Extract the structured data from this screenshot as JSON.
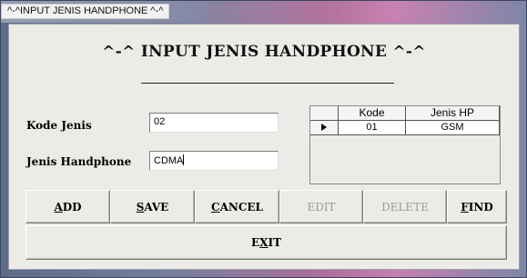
{
  "window": {
    "title": "^-^INPUT JENIS HANDPHONE ^-^"
  },
  "form": {
    "heading": "^-^ INPUT JENIS HANDPHONE ^-^",
    "kode_label": "Kode Jenis",
    "kode_value": "02",
    "jenis_label": "Jenis Handphone",
    "jenis_value": "CDMA"
  },
  "grid": {
    "columns": [
      "Kode",
      "Jenis HP"
    ],
    "rows": [
      {
        "kode": "01",
        "jenis": "GSM",
        "selected": true
      }
    ]
  },
  "buttons": {
    "add": {
      "mnemonic": "A",
      "rest": "DD",
      "enabled": true
    },
    "save": {
      "mnemonic": "S",
      "rest": "AVE",
      "enabled": true
    },
    "cancel": {
      "mnemonic": "C",
      "rest": "ANCEL",
      "enabled": true
    },
    "edit": {
      "label": "EDIT",
      "enabled": false
    },
    "delete": {
      "label": "DELETE",
      "enabled": false
    },
    "find": {
      "mnemonic": "F",
      "rest": "IND",
      "enabled": true
    },
    "exit": {
      "prefix": "E",
      "mnemonic": "X",
      "rest": "IT",
      "enabled": true
    }
  },
  "icons": {
    "row_selector": "current-row-arrow-icon"
  }
}
